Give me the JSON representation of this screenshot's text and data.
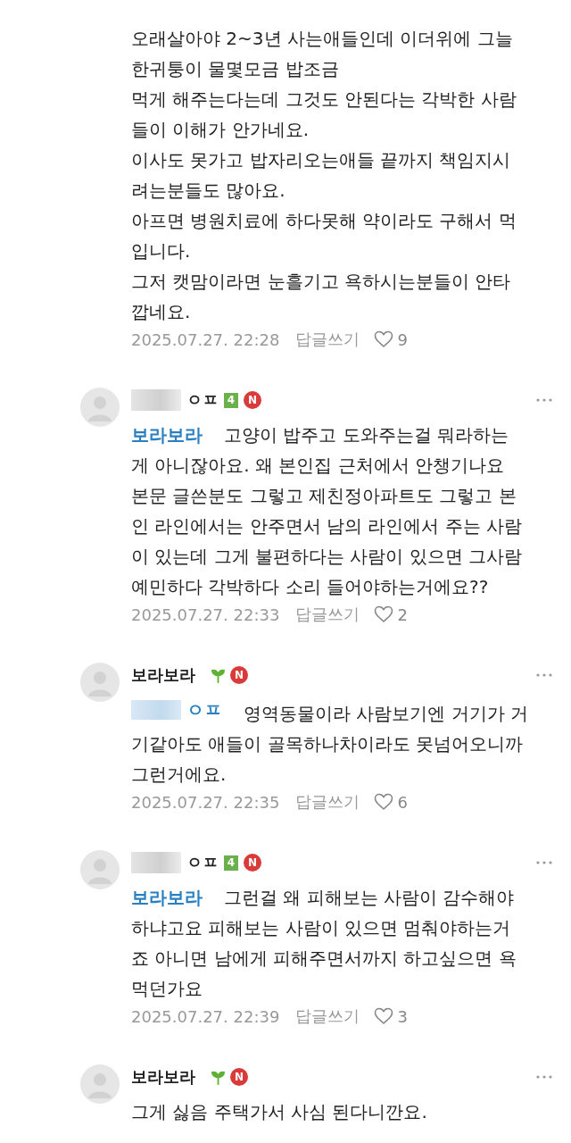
{
  "comments": [
    {
      "body": "오래살아야 2~3년 사는애들인데 이더위에 그늘\n한귀퉁이 물몇모금 밥조금\n먹게 해주는다는데 그것도 안된다는 각박한 사람\n들이 이해가 안가네요.\n이사도 못가고 밥자리오는애들 끝까지 책임지시\n려는분들도 많아요.\n아프면 병원치료에 하다못해 약이라도 구해서 먹\n입니다.\n그저 캣맘이라면 눈흘기고 욕하시는분들이 안타\n깝네요.",
      "date": "2025.07.27. 22:28",
      "reply": "답글쓰기",
      "likes": "9"
    },
    {
      "author": {
        "name": "ㅇㅍ",
        "redacted": true,
        "badge": {
          "kind": "level",
          "text": "4"
        },
        "n_badge": "N"
      },
      "mention": {
        "name": "보라보라",
        "redacted": false
      },
      "body": "고양이 밥주고 도와주는걸 뭐라하는\n게 아니잖아요. 왜 본인집 근처에서 안챙기나요\n본문 글쓴분도 그렇고 제친정아파트도 그렇고 본\n인 라인에서는 안주면서 남의 라인에서 주는 사람\n이 있는데 그게 불편하다는 사람이 있으면 그사람\n예민하다 각박하다 소리 들어야하는거에요??",
      "date": "2025.07.27. 22:33",
      "reply": "답글쓰기",
      "likes": "2"
    },
    {
      "author": {
        "name": "보라보라",
        "redacted": false,
        "badge": {
          "kind": "sprout"
        },
        "n_badge": "N"
      },
      "mention": {
        "name": "ㅇㅍ",
        "redacted": true
      },
      "body": "영역동물이라 사람보기엔 거기가 거\n기같아도 애들이 골목하나차이라도 못넘어오니까\n그런거에요.",
      "date": "2025.07.27. 22:35",
      "reply": "답글쓰기",
      "likes": "6"
    },
    {
      "author": {
        "name": "ㅇㅍ",
        "redacted": true,
        "badge": {
          "kind": "level",
          "text": "4"
        },
        "n_badge": "N"
      },
      "mention": {
        "name": "보라보라",
        "redacted": false
      },
      "body": "그런걸 왜 피해보는 사람이 감수해야\n하냐고요 피해보는 사람이 있으면 멈춰야하는거\n죠 아니면 남에게 피해주면서까지 하고싶으면 욕\n먹던가요",
      "date": "2025.07.27. 22:39",
      "reply": "답글쓰기",
      "likes": "3"
    },
    {
      "author": {
        "name": "보라보라",
        "redacted": false,
        "badge": {
          "kind": "sprout"
        },
        "n_badge": "N"
      },
      "body": "그게 싫음 주택가서 사심 된다니깐요."
    }
  ]
}
